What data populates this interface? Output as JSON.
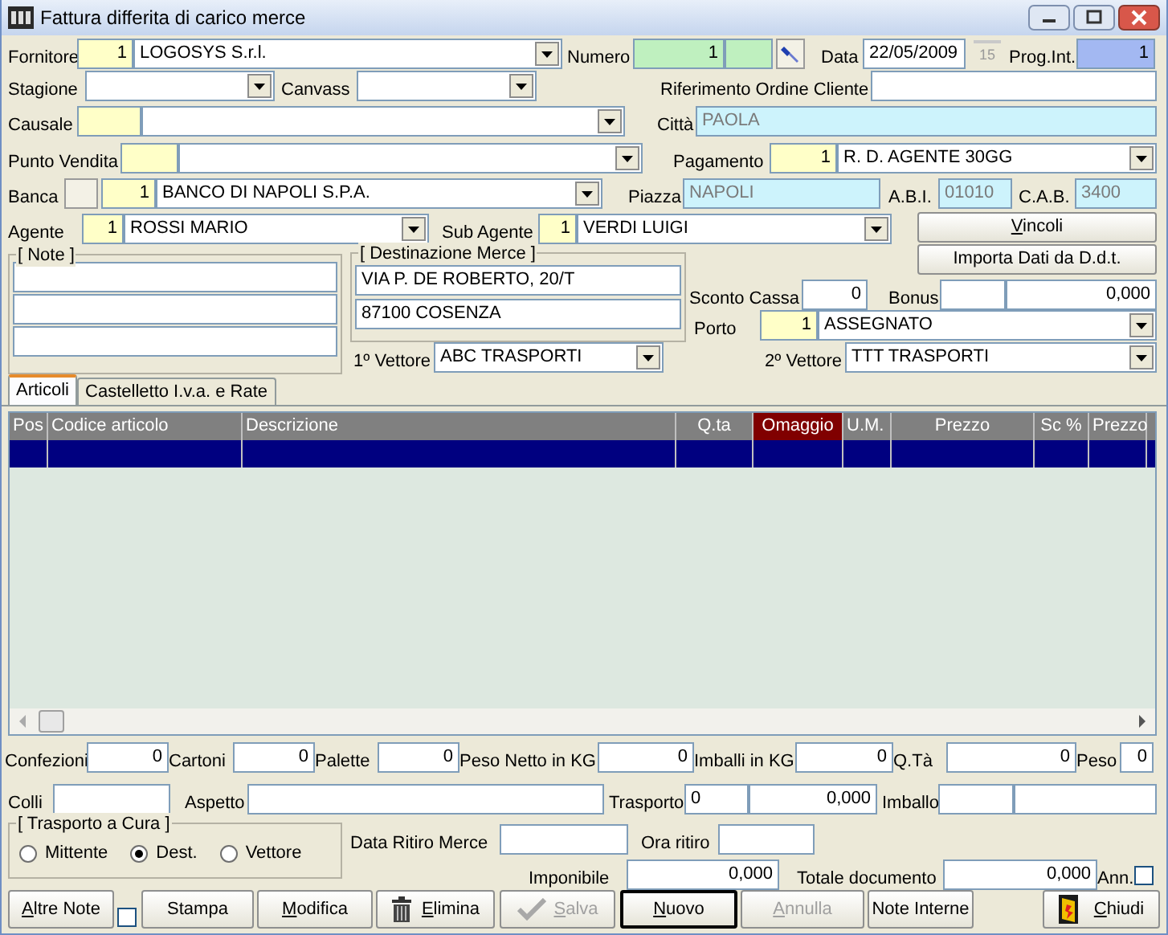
{
  "window": {
    "title": "Fattura differita di carico merce"
  },
  "header": {
    "fornitore": {
      "label": "Fornitore",
      "code": "1",
      "value": "LOGOSYS S.r.l."
    },
    "numero": {
      "label": "Numero",
      "value": "1"
    },
    "data": {
      "label": "Data",
      "value": "22/05/2009",
      "calendar_day": "15"
    },
    "prog_int": {
      "label": "Prog.Int.",
      "value": "1"
    },
    "stagione": {
      "label": "Stagione"
    },
    "canvass": {
      "label": "Canvass"
    },
    "riferimento": {
      "label": "Riferimento Ordine Cliente"
    },
    "causale": {
      "label": "Causale"
    },
    "citta": {
      "label": "Città",
      "value": "PAOLA"
    },
    "punto_vendita": {
      "label": "Punto Vendita"
    },
    "pagamento": {
      "label": "Pagamento",
      "code": "1",
      "value": "R. D. AGENTE 30GG"
    },
    "banca": {
      "label": "Banca",
      "code": "1",
      "value": "BANCO DI NAPOLI S.P.A."
    },
    "piazza": {
      "label": "Piazza",
      "value": "NAPOLI"
    },
    "abi": {
      "label": "A.B.I.",
      "value": "01010"
    },
    "cab": {
      "label": "C.A.B.",
      "value": "3400"
    },
    "agente": {
      "label": "Agente",
      "code": "1",
      "value": "ROSSI MARIO"
    },
    "sub_agente": {
      "label": "Sub Agente",
      "code": "1",
      "value": "VERDI LUIGI"
    },
    "vincoli_button": {
      "label": "Vincoli",
      "underline_first": true
    },
    "note": {
      "title": "[ Note ]"
    },
    "destinazione": {
      "title": "[ Destinazione Merce ]",
      "lines": [
        "VIA P. DE ROBERTO, 20/T",
        "87100 COSENZA"
      ]
    },
    "importa_button": {
      "label": "Importa Dati da D.d.t.",
      "underline_first": false
    },
    "sconto_cassa": {
      "label": "Sconto Cassa",
      "value": "0"
    },
    "bonus": {
      "label": "Bonus",
      "value": "0,000"
    },
    "porto": {
      "label": "Porto",
      "code": "1",
      "value": "ASSEGNATO"
    },
    "vettore_1": {
      "label": "1º Vettore",
      "value": "ABC TRASPORTI"
    },
    "vettore_2": {
      "label": "2º Vettore",
      "value": "TTT TRASPORTI"
    }
  },
  "tabs": [
    {
      "label": "Articoli",
      "selected": true
    },
    {
      "label": "Castelletto I.v.a. e Rate",
      "selected": false
    }
  ],
  "grid": {
    "columns": [
      {
        "label": "Pos",
        "highlighted": false
      },
      {
        "label": "Codice articolo",
        "highlighted": false
      },
      {
        "label": "Descrizione",
        "highlighted": false
      },
      {
        "label": "Q.ta",
        "highlighted": false
      },
      {
        "label": "Omaggio",
        "highlighted": true
      },
      {
        "label": "U.M.",
        "highlighted": false
      },
      {
        "label": "Prezzo",
        "highlighted": false
      },
      {
        "label": "Sc %",
        "highlighted": false
      },
      {
        "label": "Prezzo",
        "highlighted": false
      }
    ],
    "rows": [
      {
        "selected": true
      }
    ]
  },
  "totals": [
    {
      "label": "Confezioni",
      "value": "0"
    },
    {
      "label": "Cartoni",
      "value": "0"
    },
    {
      "label": "Palette",
      "value": "0"
    },
    {
      "label": "Peso Netto in KG",
      "value": "0"
    },
    {
      "label": "Imballi in KG",
      "value": "0"
    },
    {
      "label": "Q.Tà",
      "value": "0"
    },
    {
      "label": "Peso",
      "value": "0"
    }
  ],
  "shipping": {
    "colli": {
      "label": "Colli"
    },
    "aspetto": {
      "label": "Aspetto"
    },
    "trasporto": {
      "label": "Trasporto",
      "quantity": "0",
      "amount": "0,000"
    },
    "imballo": {
      "label": "Imballo"
    }
  },
  "footer": {
    "trasporto_a_cura": {
      "title": "[ Trasporto a Cura ]",
      "options": [
        {
          "label": "Mittente",
          "selected": false
        },
        {
          "label": "Dest.",
          "selected": true
        },
        {
          "label": "Vettore",
          "selected": false
        }
      ]
    },
    "data_ritiro": {
      "label": "Data Ritiro Merce"
    },
    "ora_ritiro": {
      "label": "Ora ritiro"
    },
    "imponibile": {
      "label": "Imponibile",
      "value": "0,000"
    },
    "totale": {
      "label": "Totale documento",
      "value": "0,000"
    },
    "annullato": {
      "label": "Ann.",
      "checked": false
    }
  },
  "buttons": [
    {
      "kind": "plain",
      "label": "Altre Note",
      "underline_first": true,
      "disabled": false,
      "focused": false
    },
    {
      "kind": "checkbox",
      "checked": false
    },
    {
      "kind": "plain",
      "label": "Stampa",
      "underline_first": false,
      "disabled": false,
      "focused": false
    },
    {
      "kind": "plain",
      "label": "Modifica",
      "underline_first": true,
      "disabled": false,
      "focused": false
    },
    {
      "kind": "delete",
      "label": "Elimina",
      "underline_first": true,
      "disabled": false,
      "focused": false
    },
    {
      "kind": "save",
      "label": "Salva",
      "underline_first": true,
      "disabled": true,
      "focused": false
    },
    {
      "kind": "plain",
      "label": "Nuovo",
      "underline_first": true,
      "disabled": false,
      "focused": true
    },
    {
      "kind": "plain",
      "label": "Annulla",
      "underline_first": true,
      "disabled": true,
      "focused": false
    },
    {
      "kind": "plain",
      "label": "Note Interne",
      "underline_first": false,
      "disabled": false,
      "focused": false
    },
    {
      "kind": "close",
      "label": "Chiudi",
      "underline_first": true,
      "disabled": false,
      "focused": false
    }
  ]
}
